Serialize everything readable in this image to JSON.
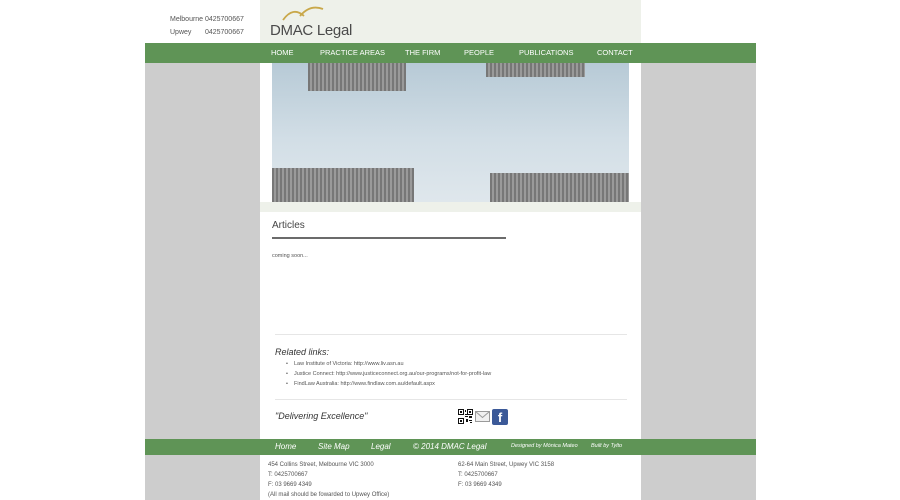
{
  "header": {
    "phones": [
      {
        "city": "Melbourne",
        "number": "0425700667"
      },
      {
        "city": "Upwey",
        "number": "0425700667"
      }
    ],
    "logo_text": "DMAC Legal"
  },
  "nav": {
    "items": [
      "HOME",
      "PRACTICE AREAS",
      "THE FIRM",
      "PEOPLE",
      "PUBLICATIONS",
      "CONTACT"
    ]
  },
  "main": {
    "title": "Articles",
    "body": "coming soon..."
  },
  "related": {
    "title": "Related links:",
    "links": [
      "Law Institute of Victoria: http://www.liv.asn.au",
      "Justice Connect: http://www.justiceconnect.org.au/our-programs/not-for-profit-law",
      "FindLaw Australia: http://www.findlaw.com.au/default.aspx"
    ]
  },
  "tagline": "\"Delivering Excellence\"",
  "footer": {
    "links": [
      "Home",
      "Site Map",
      "Legal"
    ],
    "copyright": "© 2014 DMAC Legal",
    "designed_by": "Designed by Mónica Mateo",
    "built_by": "Built by Tylto"
  },
  "addresses": {
    "melbourne": {
      "street": "454 Collins Street, Melbourne VIC 3000",
      "phone": "T: 0425700667",
      "fax": "F: 03 9669 4349",
      "note": "(All mail should be fowarded to Upwey Office)"
    },
    "upwey": {
      "street": "62-64 Main Street, Upwey VIC 3158",
      "phone": "T: 0425700667",
      "fax": "F: 03 9669 4349"
    }
  },
  "colors": {
    "nav_green": "#5f9456",
    "panel_tint": "#eef1ea",
    "side_gray": "#cdcdcd",
    "logo_gold": "#c9a84a"
  }
}
